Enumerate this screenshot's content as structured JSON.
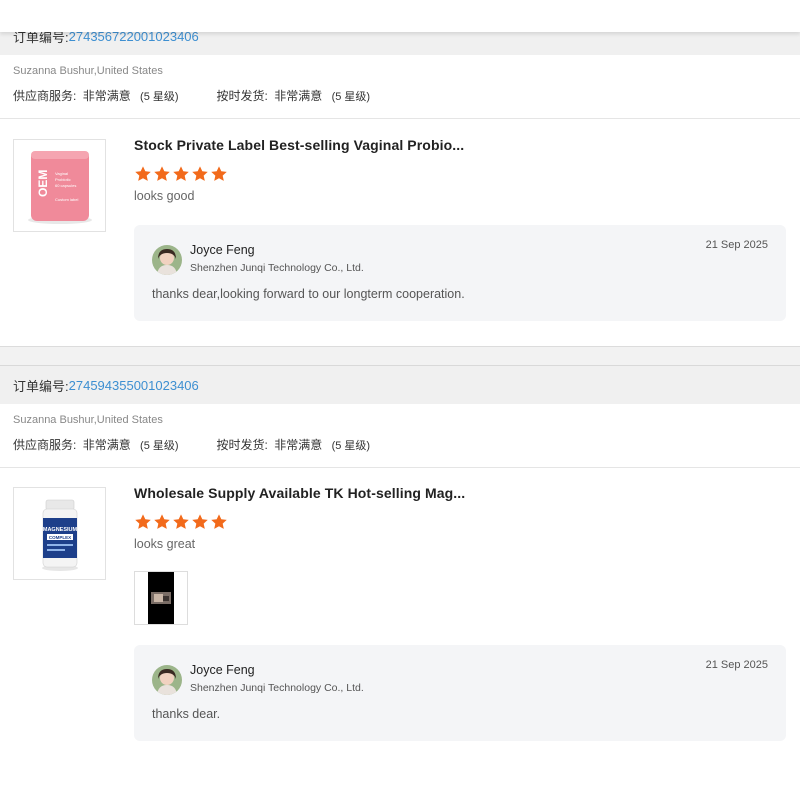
{
  "orders": [
    {
      "order_label": "订单编号:",
      "order_number": "274356722001023406",
      "buyer": "Suzanna Bushur,United States",
      "supplier_service_label": "供应商服务:",
      "supplier_service_value": "非常满意",
      "supplier_service_level": "(5 星级)",
      "shipping_label": "按时发货:",
      "shipping_value": "非常满意",
      "shipping_level": "(5 星级)",
      "product_title": "Stock Private Label Best-selling Vaginal Probio...",
      "rating": 5,
      "review": "looks good",
      "reply": {
        "author": "Joyce Feng",
        "company": "Shenzhen Junqi Technology Co., Ltd.",
        "date": "21 Sep 2025",
        "text": "thanks dear,looking forward to our longterm cooperation."
      }
    },
    {
      "order_label": "订单编号:",
      "order_number": "274594355001023406",
      "buyer": "Suzanna Bushur,United States",
      "supplier_service_label": "供应商服务:",
      "supplier_service_value": "非常满意",
      "supplier_service_level": "(5 星级)",
      "shipping_label": "按时发货:",
      "shipping_value": "非常满意",
      "shipping_level": "(5 星级)",
      "product_title": "Wholesale Supply Available TK Hot-selling Mag...",
      "rating": 5,
      "review": "looks great",
      "reply": {
        "author": "Joyce Feng",
        "company": "Shenzhen Junqi Technology Co., Ltd.",
        "date": "21 Sep 2025",
        "text": "thanks dear."
      }
    }
  ],
  "product_images": {
    "first": {
      "brand": "OEM",
      "lines": [
        "Vaginal",
        "Probiotic",
        "60 capsules"
      ],
      "footer": "Custom label",
      "color": "#f08a9a"
    },
    "second": {
      "brand": "MAGNESIUM",
      "sub": "COMPLEX",
      "color": "#1d3f8a"
    }
  },
  "colors": {
    "star": "#f26a1b",
    "link": "#3d8fd1"
  },
  "icons": {
    "rating_star": "star-icon"
  }
}
